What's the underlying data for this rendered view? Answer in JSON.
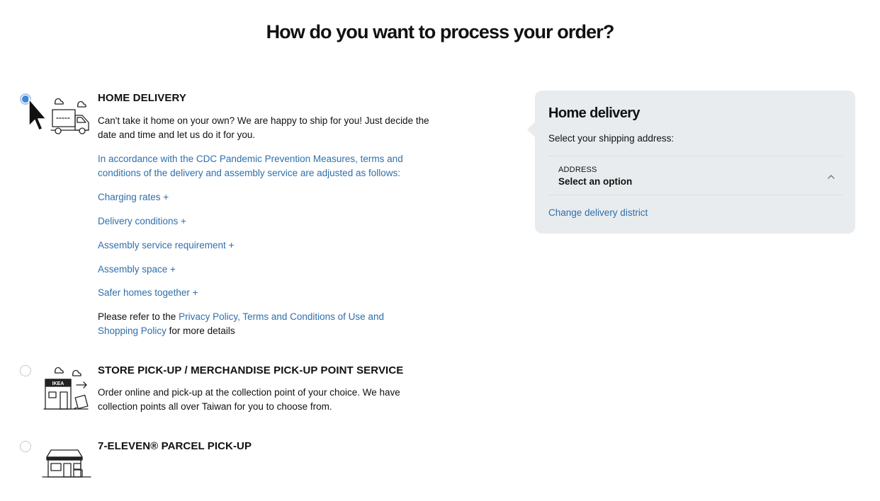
{
  "page": {
    "title": "How do you want to process your order?"
  },
  "options": {
    "home_delivery": {
      "title": "HOME DELIVERY",
      "selected": true,
      "icon": "delivery-truck-icon",
      "description": "Can't take it home on your own? We are happy to ship for you! Just decide the date and time and let us do it for you.",
      "notice": "In accordance with the CDC Pandemic Prevention Measures, terms and conditions of the delivery and assembly service are adjusted as follows:",
      "expanders": [
        "Charging rates +",
        "Delivery conditions +",
        "Assembly service requirement +",
        "Assembly space +",
        "Safer homes together +"
      ],
      "policy_prefix": "Please refer to the ",
      "policy_link": "Privacy Policy, Terms and Conditions of Use and Shopping Policy",
      "policy_suffix": " for more details"
    },
    "store_pickup": {
      "title": "STORE PICK-UP / MERCHANDISE PICK-UP POINT SERVICE",
      "selected": false,
      "icon": "ikea-store-icon",
      "description": "Order online and pick-up at the collection point of your choice. We have collection points all over Taiwan for you to choose from."
    },
    "seven_eleven": {
      "title": "7-ELEVEN® PARCEL PICK-UP",
      "selected": false,
      "icon": "convenience-store-icon"
    }
  },
  "panel": {
    "title": "Home delivery",
    "subtitle": "Select your shipping address:",
    "address_label": "ADDRESS",
    "address_value": "Select an option",
    "change_district": "Change delivery district"
  },
  "colors": {
    "link": "#2e6fad",
    "radio_selected": "#3e86d4",
    "panel_bg": "#e9ecee",
    "text": "#111111"
  }
}
